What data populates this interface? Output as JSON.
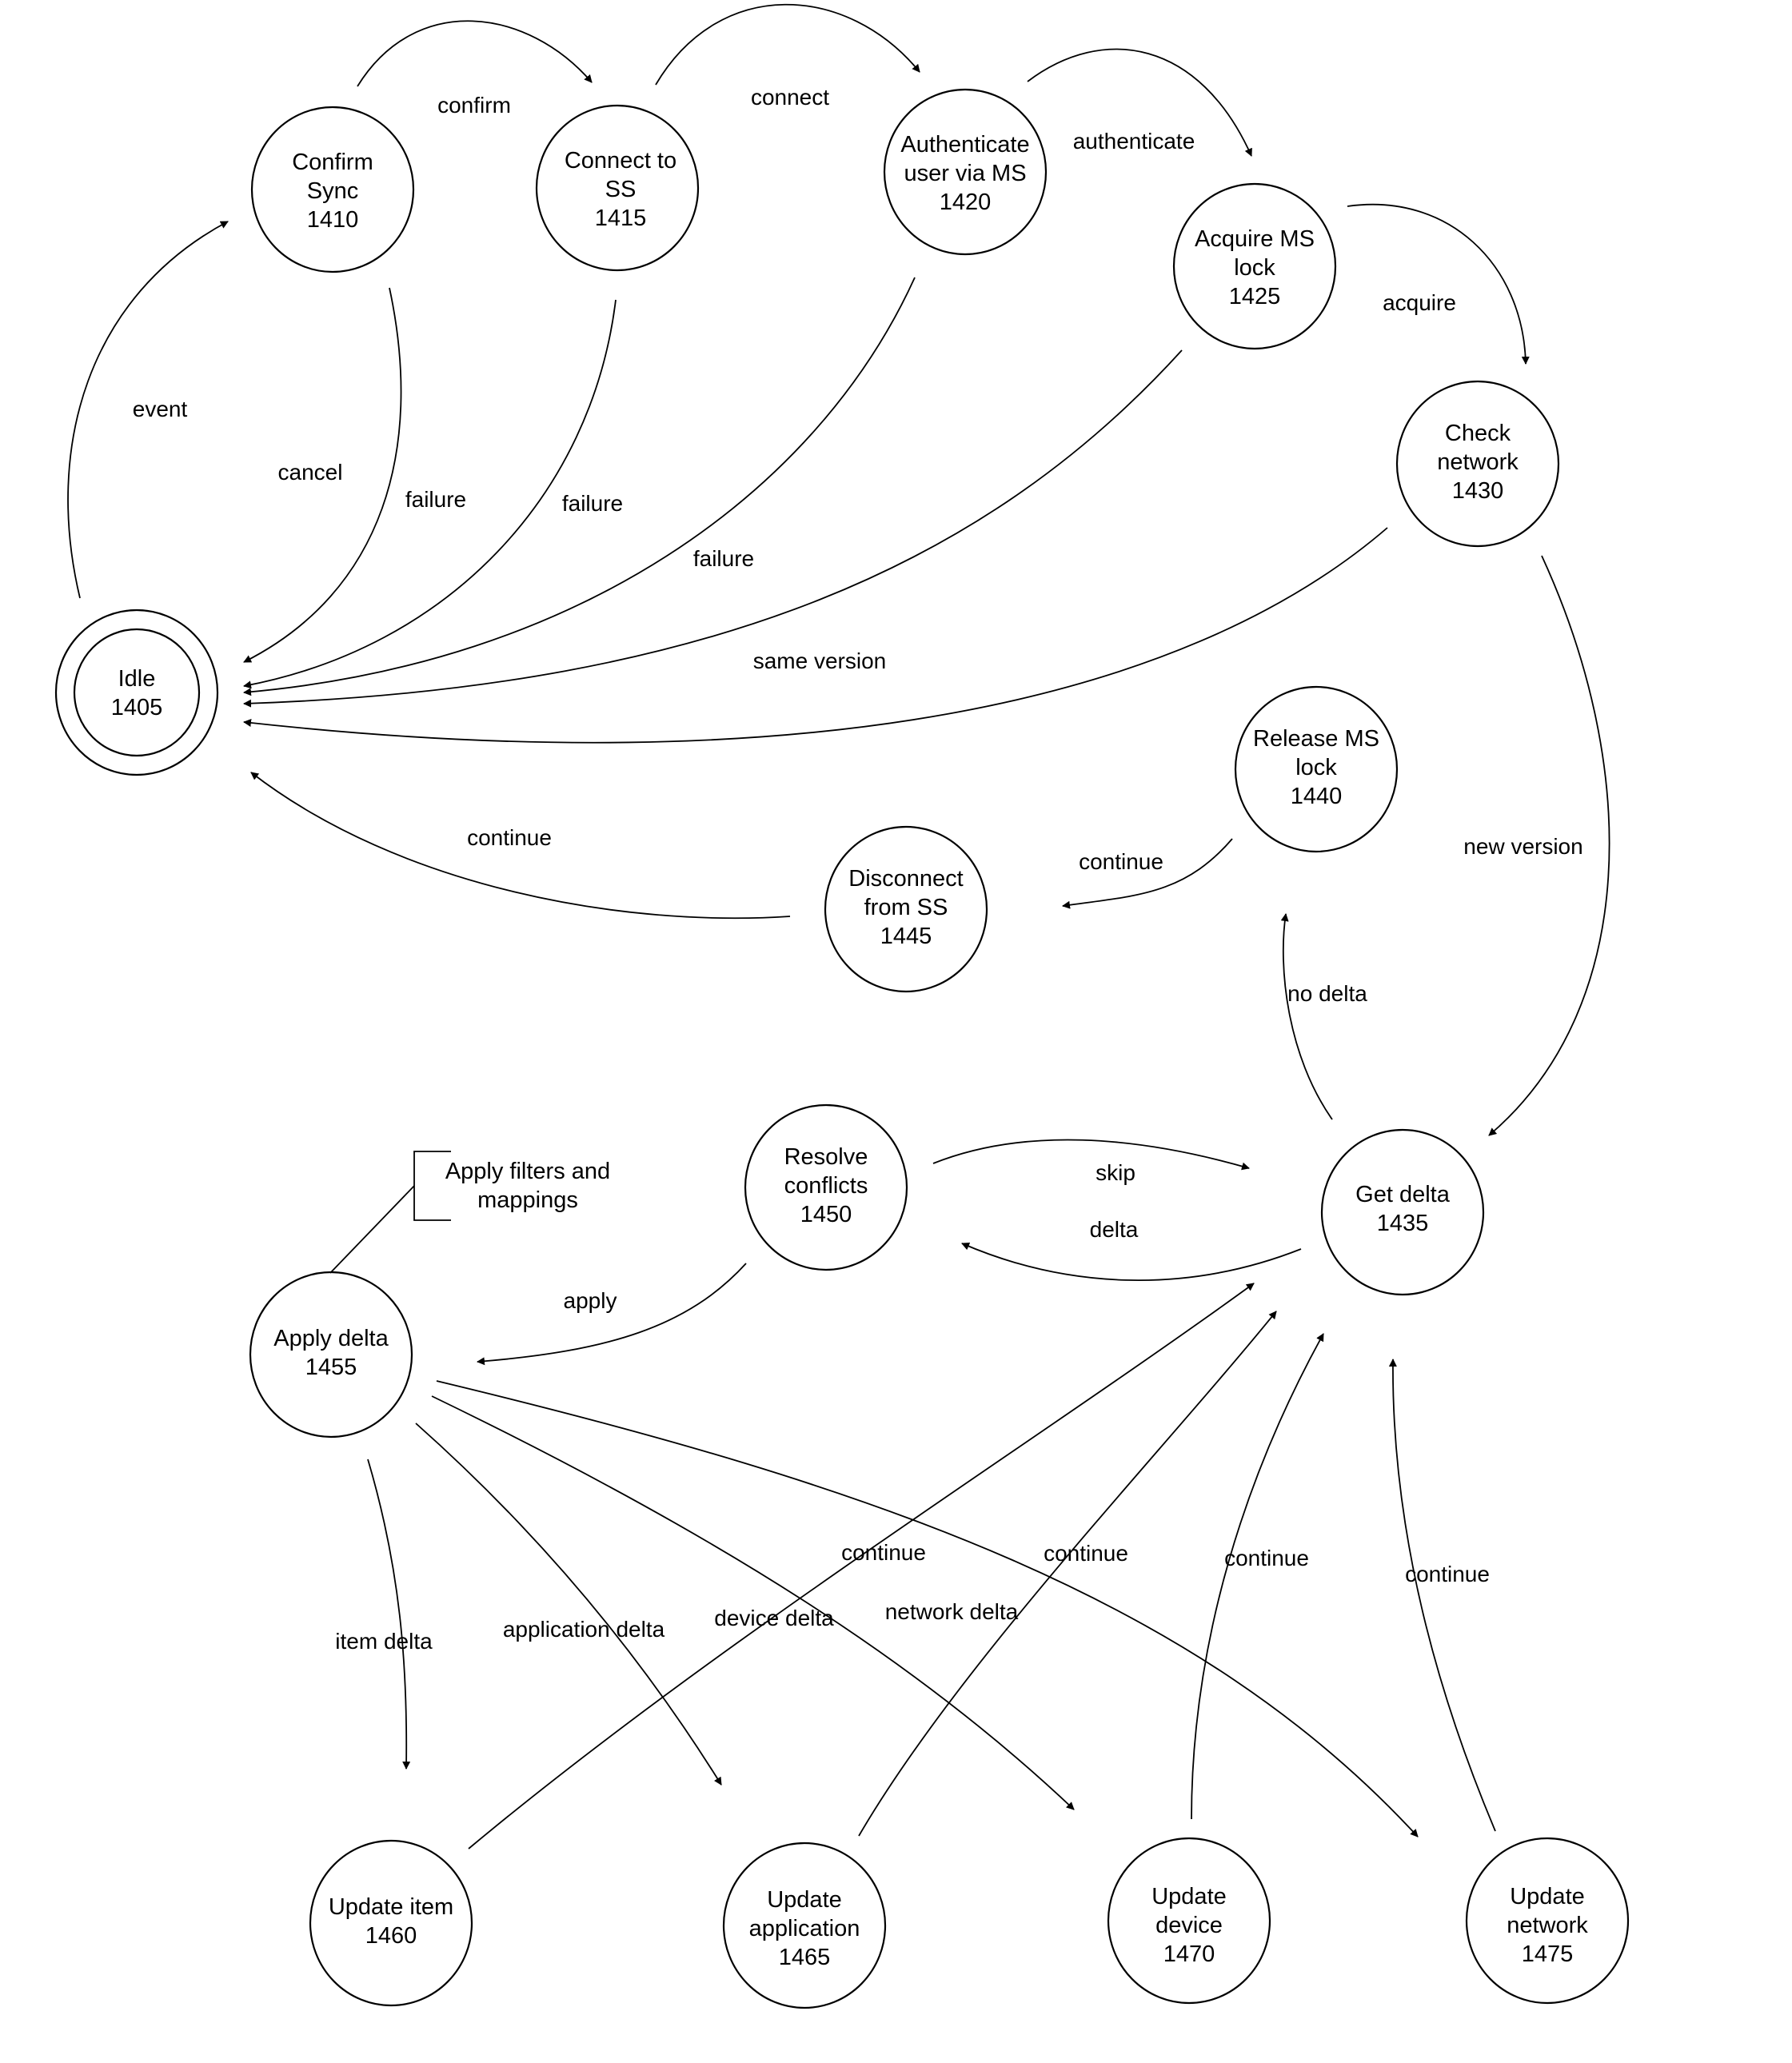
{
  "diagram": {
    "type": "state-transition",
    "nodes": [
      {
        "id": "1405",
        "lines": [
          "Idle",
          "1405"
        ],
        "initial": true
      },
      {
        "id": "1410",
        "lines": [
          "Confirm",
          "Sync",
          "1410"
        ]
      },
      {
        "id": "1415",
        "lines": [
          "Connect to",
          "SS",
          "1415"
        ]
      },
      {
        "id": "1420",
        "lines": [
          "Authenticate",
          "user via MS",
          "1420"
        ]
      },
      {
        "id": "1425",
        "lines": [
          "Acquire MS",
          "lock",
          "1425"
        ]
      },
      {
        "id": "1430",
        "lines": [
          "Check",
          "network",
          "1430"
        ]
      },
      {
        "id": "1435",
        "lines": [
          "Get delta",
          "1435"
        ]
      },
      {
        "id": "1440",
        "lines": [
          "Release MS",
          "lock",
          "1440"
        ]
      },
      {
        "id": "1445",
        "lines": [
          "Disconnect",
          "from SS",
          "1445"
        ]
      },
      {
        "id": "1450",
        "lines": [
          "Resolve",
          "conflicts",
          "1450"
        ]
      },
      {
        "id": "1455",
        "lines": [
          "Apply delta",
          "1455"
        ]
      },
      {
        "id": "1460",
        "lines": [
          "Update item",
          "1460"
        ]
      },
      {
        "id": "1465",
        "lines": [
          "Update",
          "application",
          "1465"
        ]
      },
      {
        "id": "1470",
        "lines": [
          "Update",
          "device",
          "1470"
        ]
      },
      {
        "id": "1475",
        "lines": [
          "Update",
          "network",
          "1475"
        ]
      }
    ],
    "edges": [
      {
        "from": "1405",
        "to": "1410",
        "label": "event"
      },
      {
        "from": "1410",
        "to": "1415",
        "label": "confirm"
      },
      {
        "from": "1415",
        "to": "1420",
        "label": "connect"
      },
      {
        "from": "1420",
        "to": "1425",
        "label": "authenticate"
      },
      {
        "from": "1425",
        "to": "1430",
        "label": "acquire"
      },
      {
        "from": "1410",
        "to": "1405",
        "label": "cancel"
      },
      {
        "from": "1415",
        "to": "1405",
        "label": "failure"
      },
      {
        "from": "1420",
        "to": "1405",
        "label": "failure"
      },
      {
        "from": "1425",
        "to": "1405",
        "label": "failure"
      },
      {
        "from": "1430",
        "to": "1405",
        "label": "same version"
      },
      {
        "from": "1430",
        "to": "1435",
        "label": "new version"
      },
      {
        "from": "1435",
        "to": "1440",
        "label": "no delta"
      },
      {
        "from": "1440",
        "to": "1445",
        "label": "continue"
      },
      {
        "from": "1445",
        "to": "1405",
        "label": "continue"
      },
      {
        "from": "1450",
        "to": "1435",
        "label": "skip"
      },
      {
        "from": "1435",
        "to": "1450",
        "label": "delta"
      },
      {
        "from": "1450",
        "to": "1455",
        "label": "apply"
      },
      {
        "from": "1455",
        "to": "1460",
        "label": "item delta"
      },
      {
        "from": "1455",
        "to": "1465",
        "label": "application delta"
      },
      {
        "from": "1455",
        "to": "1470",
        "label": "device delta"
      },
      {
        "from": "1455",
        "to": "1475",
        "label": "network delta"
      },
      {
        "from": "1460",
        "to": "1435",
        "label": "continue"
      },
      {
        "from": "1465",
        "to": "1435",
        "label": "continue"
      },
      {
        "from": "1470",
        "to": "1435",
        "label": "continue"
      },
      {
        "from": "1475",
        "to": "1435",
        "label": "continue"
      }
    ],
    "annotations": [
      {
        "attached_to": "1455",
        "lines": [
          "Apply filters and",
          "mappings"
        ]
      }
    ]
  }
}
